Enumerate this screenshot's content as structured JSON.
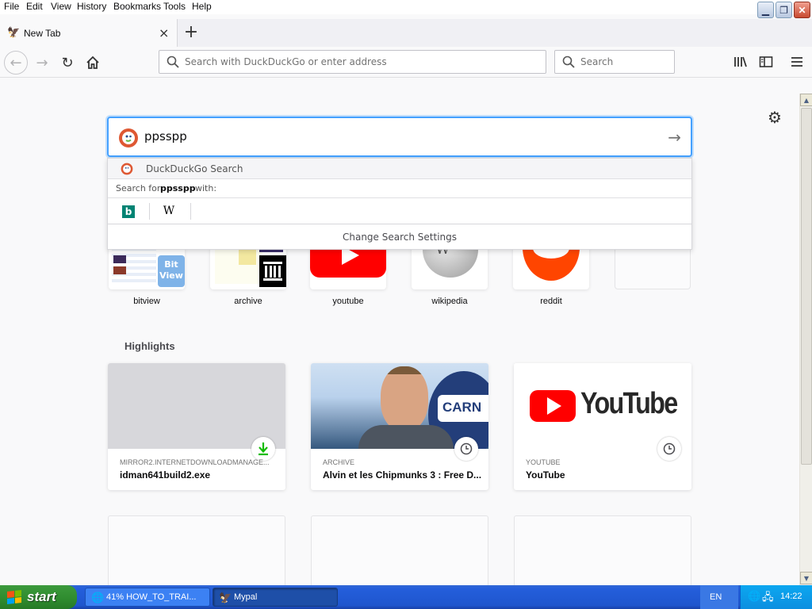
{
  "menu": [
    "File",
    "Edit",
    "View",
    "History",
    "Bookmarks",
    "Tools",
    "Help"
  ],
  "window_controls": {
    "minimize": "▁",
    "restore": "❐",
    "close": "✕"
  },
  "tab": {
    "title": "New Tab",
    "close": "×",
    "new_tab": "+"
  },
  "nav": {
    "url_placeholder": "Search with DuckDuckGo or enter address",
    "search_placeholder": "Search"
  },
  "search_box": {
    "value": "ppsspp"
  },
  "dropdown": {
    "engine_label": "DuckDuckGo Search",
    "search_for_prefix": "Search for",
    "query": "ppsspp",
    "search_for_suffix": "with:",
    "engines": [
      {
        "name": "b"
      },
      {
        "name": "W"
      }
    ],
    "settings_label": "Change Search Settings"
  },
  "top_sites": [
    {
      "label": "bitview"
    },
    {
      "label": "archive"
    },
    {
      "label": "youtube"
    },
    {
      "label": "wikipedia"
    },
    {
      "label": "reddit"
    },
    {
      "label": ""
    }
  ],
  "highlights": {
    "title": "Highlights",
    "cards": [
      {
        "source": "MIRROR2.INTERNETDOWNLOADMANAGE...",
        "title": "idman641build2.exe",
        "badge": "download-icon"
      },
      {
        "source": "ARCHIVE",
        "title": "Alvin et les Chipmunks 3 : Free D...",
        "badge": "clock-icon"
      },
      {
        "source": "YOUTUBE",
        "title": "YouTube",
        "badge": "clock-icon"
      }
    ]
  },
  "taskbar": {
    "start_label": "start",
    "tasks": [
      {
        "label": "41% HOW_TO_TRAI..."
      },
      {
        "label": "Mypal"
      }
    ],
    "language": "EN",
    "clock": "14:22"
  },
  "colors": {
    "accent": "#45a1ff",
    "taskbar": "#245edb",
    "start": "#2e8b2e",
    "youtube_red": "#ff0000",
    "reddit": "#ff4500"
  }
}
